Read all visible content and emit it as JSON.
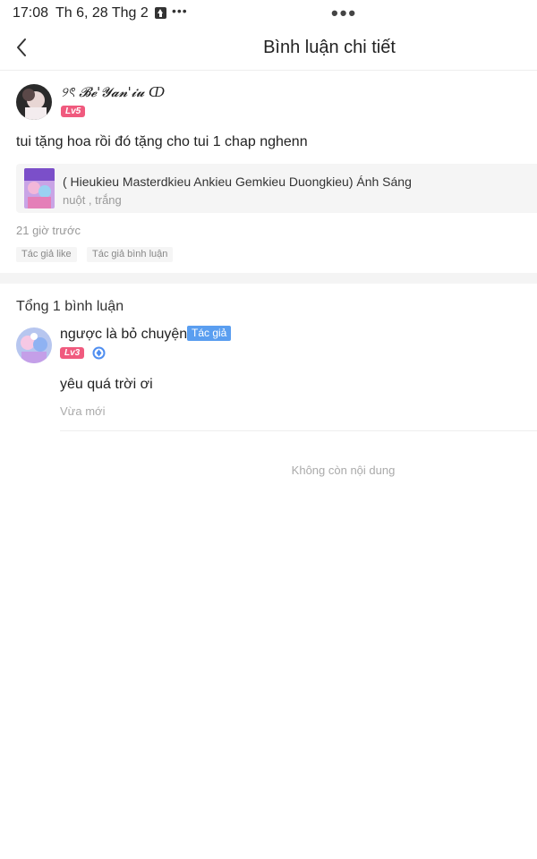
{
  "status_bar": {
    "time": "17:08",
    "date": "Th 6, 28 Thg 2",
    "small_dots": "•••",
    "center_dots": "•••"
  },
  "nav": {
    "title": "Bình luận chi tiết",
    "back_icon": "chevron-left-icon"
  },
  "post": {
    "author_name": "୨ৎ 𝓑𝓮'𝓨𝓪𝓷'𝓲𝓾 ↀ",
    "level": "Lv5",
    "text": "tui tặng hoa rồi đó tặng cho tui 1 chap nghenn",
    "book": {
      "title": "( Hieukieu Masterdkieu Ankieu Gemkieu Duongkieu) Ánh Sáng",
      "subtitle": "nuột , trắng"
    },
    "time": "21 giờ trước",
    "tags": [
      "Tác giả like",
      "Tác giả bình luận"
    ]
  },
  "replies_section": {
    "total": "Tổng 1 bình luận",
    "replies": [
      {
        "name": "ngược là bỏ chuyện",
        "author_badge": "Tác giả",
        "level": "Lv3",
        "verified_icon": "diamond-badge-icon",
        "text": "yêu quá trời ơi",
        "time": "Vừa mới"
      }
    ],
    "end_text": "Không còn nội dung"
  },
  "colors": {
    "level_badge": "#f05a7e",
    "author_badge": "#5a9ef0",
    "muted_text": "#999999"
  }
}
